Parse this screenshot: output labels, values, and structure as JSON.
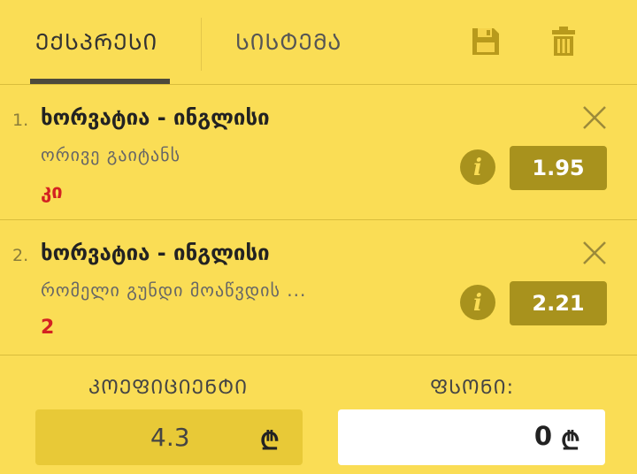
{
  "tabs": [
    {
      "label": "ᲔᲥᲡᲞᲠᲔᲡᲘ",
      "active": true
    },
    {
      "label": "ᲡᲘᲡᲢᲔᲛᲐ",
      "active": false
    }
  ],
  "header": {
    "save_icon": "save-icon",
    "trash_icon": "trash-icon"
  },
  "bets": [
    {
      "number": "1.",
      "title": "ხორვატია - ინგლისი",
      "market": "ორივე გაიტანს",
      "pick": "კი",
      "odds": "1.95"
    },
    {
      "number": "2.",
      "title": "ხორვატია - ინგლისი",
      "market": "რომელი გუნდი მოაწვდის ...",
      "pick": "2",
      "odds": "2.21"
    }
  ],
  "footer": {
    "coef_label": "ᲙᲝᲔᲤᲘᲪᲘᲔᲜᲢᲘ",
    "coef_value": "4.3",
    "stake_label": "ᲤᲡᲝᲜᲘ:",
    "stake_value": "0",
    "currency": "₾"
  },
  "colors": {
    "background": "#fadd55",
    "odds_bg": "#a8921d",
    "pick": "#d32222"
  }
}
